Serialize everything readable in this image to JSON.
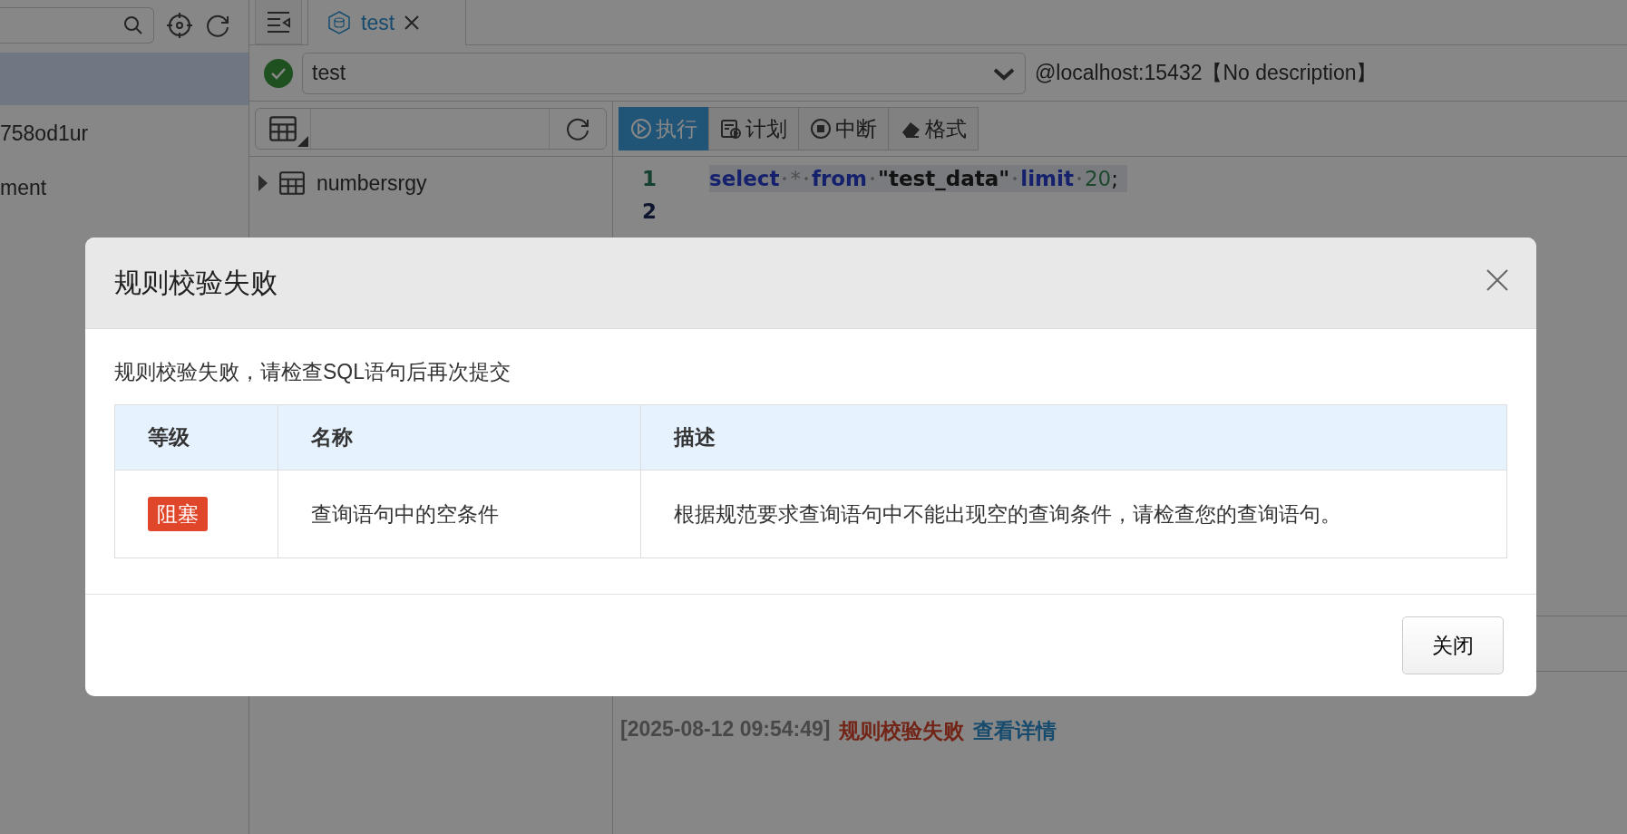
{
  "sidebar": {
    "items": [
      {
        "selected": true
      },
      {
        "label": "758od1ur",
        "selected": false
      },
      {
        "label": "ment",
        "selected": false
      }
    ]
  },
  "tabs": [
    {
      "label": "test",
      "selected": true
    }
  ],
  "connection": {
    "database": "test",
    "host": "@localhost:15432【No description】"
  },
  "object_tree": {
    "items": [
      {
        "name": "numbersrgy",
        "expanded": false
      }
    ]
  },
  "toolbar": [
    {
      "label": "执行",
      "selected": true
    },
    {
      "label": "计划",
      "selected": false
    },
    {
      "label": "中断",
      "selected": false
    },
    {
      "label": "格式",
      "selected": false
    }
  ],
  "editor": {
    "lines": [
      {
        "number": "1",
        "highlighted": true,
        "tokens": [
          {
            "kind": "keyword",
            "text": "select"
          },
          {
            "kind": "operator",
            "text": "*"
          },
          {
            "kind": "keyword",
            "text": "from"
          },
          {
            "kind": "string",
            "text": "\"test_data\""
          },
          {
            "kind": "keyword",
            "text": "limit"
          },
          {
            "kind": "number",
            "text": "20"
          },
          {
            "kind": "punct",
            "text": ";"
          }
        ]
      },
      {
        "number": "2",
        "highlighted": false
      }
    ]
  },
  "log": [
    {
      "time": "[2025-08-12 09:54:49]",
      "message": "规则校验失败",
      "link": "查看详情"
    }
  ],
  "dialog": {
    "title": "规则校验失败",
    "message": "规则校验失败，请检查SQL语句后再次提交",
    "table": {
      "columns": [
        "等级",
        "名称",
        "描述"
      ],
      "rows": [
        {
          "level": {
            "label": "阻塞",
            "color": "#e0462a"
          },
          "name": "查询语句中的空条件",
          "description": "根据规范要求查询语句中不能出现空的查询条件，请检查您的查询语句。"
        }
      ]
    },
    "buttons": [
      "关闭"
    ]
  }
}
